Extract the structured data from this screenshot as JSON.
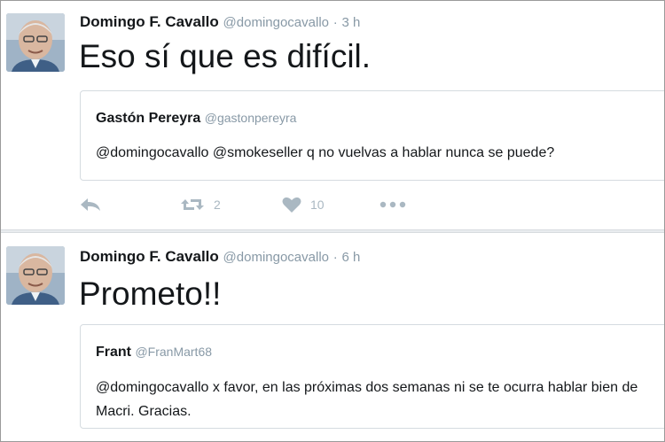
{
  "tweets": [
    {
      "author_name": "Domingo F. Cavallo",
      "author_handle": "@domingocavallo",
      "separator": "·",
      "time": "3 h",
      "text": "Eso sí que es difícil.",
      "quote": {
        "author_name": "Gastón Pereyra",
        "author_handle": "@gastonpereyra",
        "text": "@domingocavallo @smokeseller q no vuelvas a hablar nunca se puede?"
      },
      "actions": {
        "reply_icon": "reply-icon",
        "retweet_icon": "retweet-icon",
        "retweet_count": "2",
        "like_icon": "heart-icon",
        "like_count": "10",
        "more_icon": "more-icon"
      }
    },
    {
      "author_name": "Domingo F. Cavallo",
      "author_handle": "@domingocavallo",
      "separator": "·",
      "time": "6 h",
      "text": "Prometo!!",
      "quote": {
        "author_name": "Frant",
        "author_handle": "@FranMart68",
        "text": "@domingocavallo x favor, en las próximas dos semanas ni se te ocurra hablar bien de Macri. Gracias."
      }
    }
  ],
  "colors": {
    "text": "#14171a",
    "muted": "#8899a6",
    "icon": "#aab8c2",
    "border": "#d5dbe0"
  }
}
